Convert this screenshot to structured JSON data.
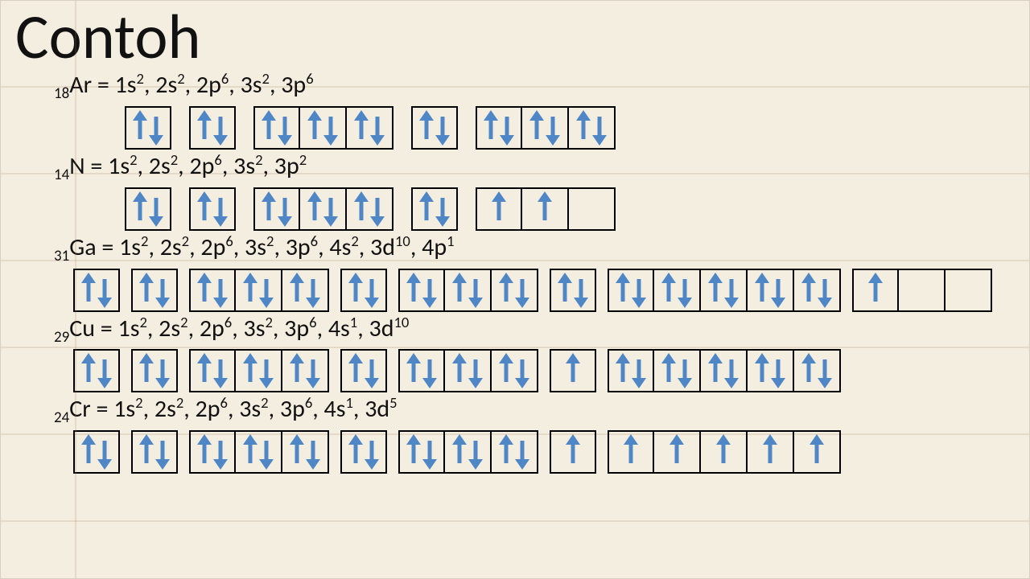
{
  "title": "Contoh",
  "elements": [
    {
      "z": "18",
      "sym": "Ar",
      "config": [
        [
          "1s",
          "2"
        ],
        [
          "2s",
          "2"
        ],
        [
          "2p",
          "6"
        ],
        [
          "3s",
          "2"
        ],
        [
          "3p",
          "6"
        ]
      ],
      "orbitals": [
        [
          "ud"
        ],
        [
          "ud"
        ],
        [
          "ud",
          "ud",
          "ud"
        ],
        [
          "ud"
        ],
        [
          "ud",
          "ud",
          "ud"
        ]
      ],
      "wide": false
    },
    {
      "z": "14",
      "sym": "N",
      "config": [
        [
          "1s",
          "2"
        ],
        [
          "2s",
          "2"
        ],
        [
          "2p",
          "6"
        ],
        [
          "3s",
          "2"
        ],
        [
          "3p",
          "2"
        ]
      ],
      "orbitals": [
        [
          "ud"
        ],
        [
          "ud"
        ],
        [
          "ud",
          "ud",
          "ud"
        ],
        [
          "ud"
        ],
        [
          "u",
          "u",
          ""
        ]
      ],
      "wide": false
    },
    {
      "z": "31",
      "sym": "Ga",
      "config": [
        [
          "1s",
          "2"
        ],
        [
          "2s",
          "2"
        ],
        [
          "2p",
          "6"
        ],
        [
          "3s",
          "2"
        ],
        [
          "3p",
          "6"
        ],
        [
          "4s",
          "2"
        ],
        [
          "3d",
          "10"
        ],
        [
          "4p",
          "1"
        ]
      ],
      "orbitals": [
        [
          "ud"
        ],
        [
          "ud"
        ],
        [
          "ud",
          "ud",
          "ud"
        ],
        [
          "ud"
        ],
        [
          "ud",
          "ud",
          "ud"
        ],
        [
          "ud"
        ],
        [
          "ud",
          "ud",
          "ud",
          "ud",
          "ud"
        ],
        [
          "u",
          "",
          ""
        ]
      ],
      "wide": true
    },
    {
      "z": "29",
      "sym": "Cu",
      "config": [
        [
          "1s",
          "2"
        ],
        [
          "2s",
          "2"
        ],
        [
          "2p",
          "6"
        ],
        [
          "3s",
          "2"
        ],
        [
          "3p",
          "6"
        ],
        [
          "4s",
          "1"
        ],
        [
          "3d",
          "10"
        ]
      ],
      "orbitals": [
        [
          "ud"
        ],
        [
          "ud"
        ],
        [
          "ud",
          "ud",
          "ud"
        ],
        [
          "ud"
        ],
        [
          "ud",
          "ud",
          "ud"
        ],
        [
          "u"
        ],
        [
          "ud",
          "ud",
          "ud",
          "ud",
          "ud"
        ]
      ],
      "wide": true
    },
    {
      "z": "24",
      "sym": "Cr",
      "config": [
        [
          "1s",
          "2"
        ],
        [
          "2s",
          "2"
        ],
        [
          "2p",
          "6"
        ],
        [
          "3s",
          "2"
        ],
        [
          "3p",
          "6"
        ],
        [
          "4s",
          "1"
        ],
        [
          "3d",
          "5"
        ]
      ],
      "orbitals": [
        [
          "ud"
        ],
        [
          "ud"
        ],
        [
          "ud",
          "ud",
          "ud"
        ],
        [
          "ud"
        ],
        [
          "ud",
          "ud",
          "ud"
        ],
        [
          "u"
        ],
        [
          "u",
          "u",
          "u",
          "u",
          "u"
        ]
      ],
      "wide": true
    }
  ]
}
